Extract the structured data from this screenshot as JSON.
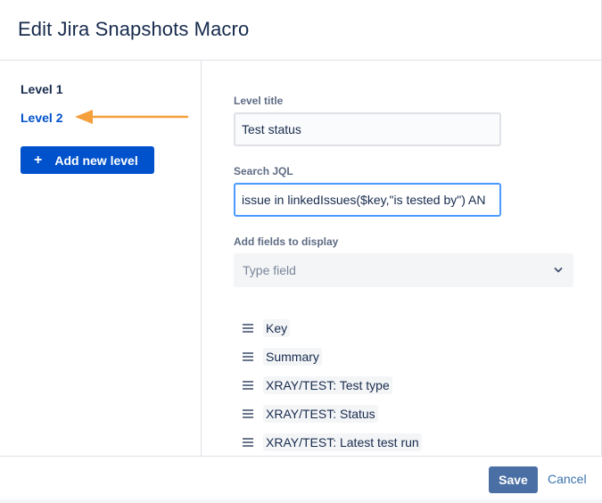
{
  "dialog": {
    "title": "Edit Jira Snapshots Macro"
  },
  "sidebar": {
    "levels": [
      {
        "label": "Level 1",
        "selected": false
      },
      {
        "label": "Level 2",
        "selected": true
      }
    ],
    "add_level_icon": "+",
    "add_level_label": "Add new level"
  },
  "form": {
    "level_title_label": "Level title",
    "level_title_value": "Test status",
    "search_jql_label": "Search JQL",
    "search_jql_value": "issue in linkedIssues($key,\"is tested by\") AN",
    "add_fields_label": "Add fields to display",
    "add_fields_placeholder": "Type field",
    "fields": [
      "Key",
      "Summary",
      "XRAY/TEST: Test type",
      "XRAY/TEST: Status",
      "XRAY/TEST: Latest test run"
    ]
  },
  "footer": {
    "save_label": "Save",
    "cancel_label": "Cancel"
  },
  "colors": {
    "primary": "#0052cc",
    "arrow": "#f5a03c",
    "save": "#4a6fa5",
    "link": "#3b73af"
  },
  "icons": {
    "arrow": "arrow-left-icon",
    "chevron": "chevron-down-icon",
    "drag": "drag-handle-icon"
  }
}
